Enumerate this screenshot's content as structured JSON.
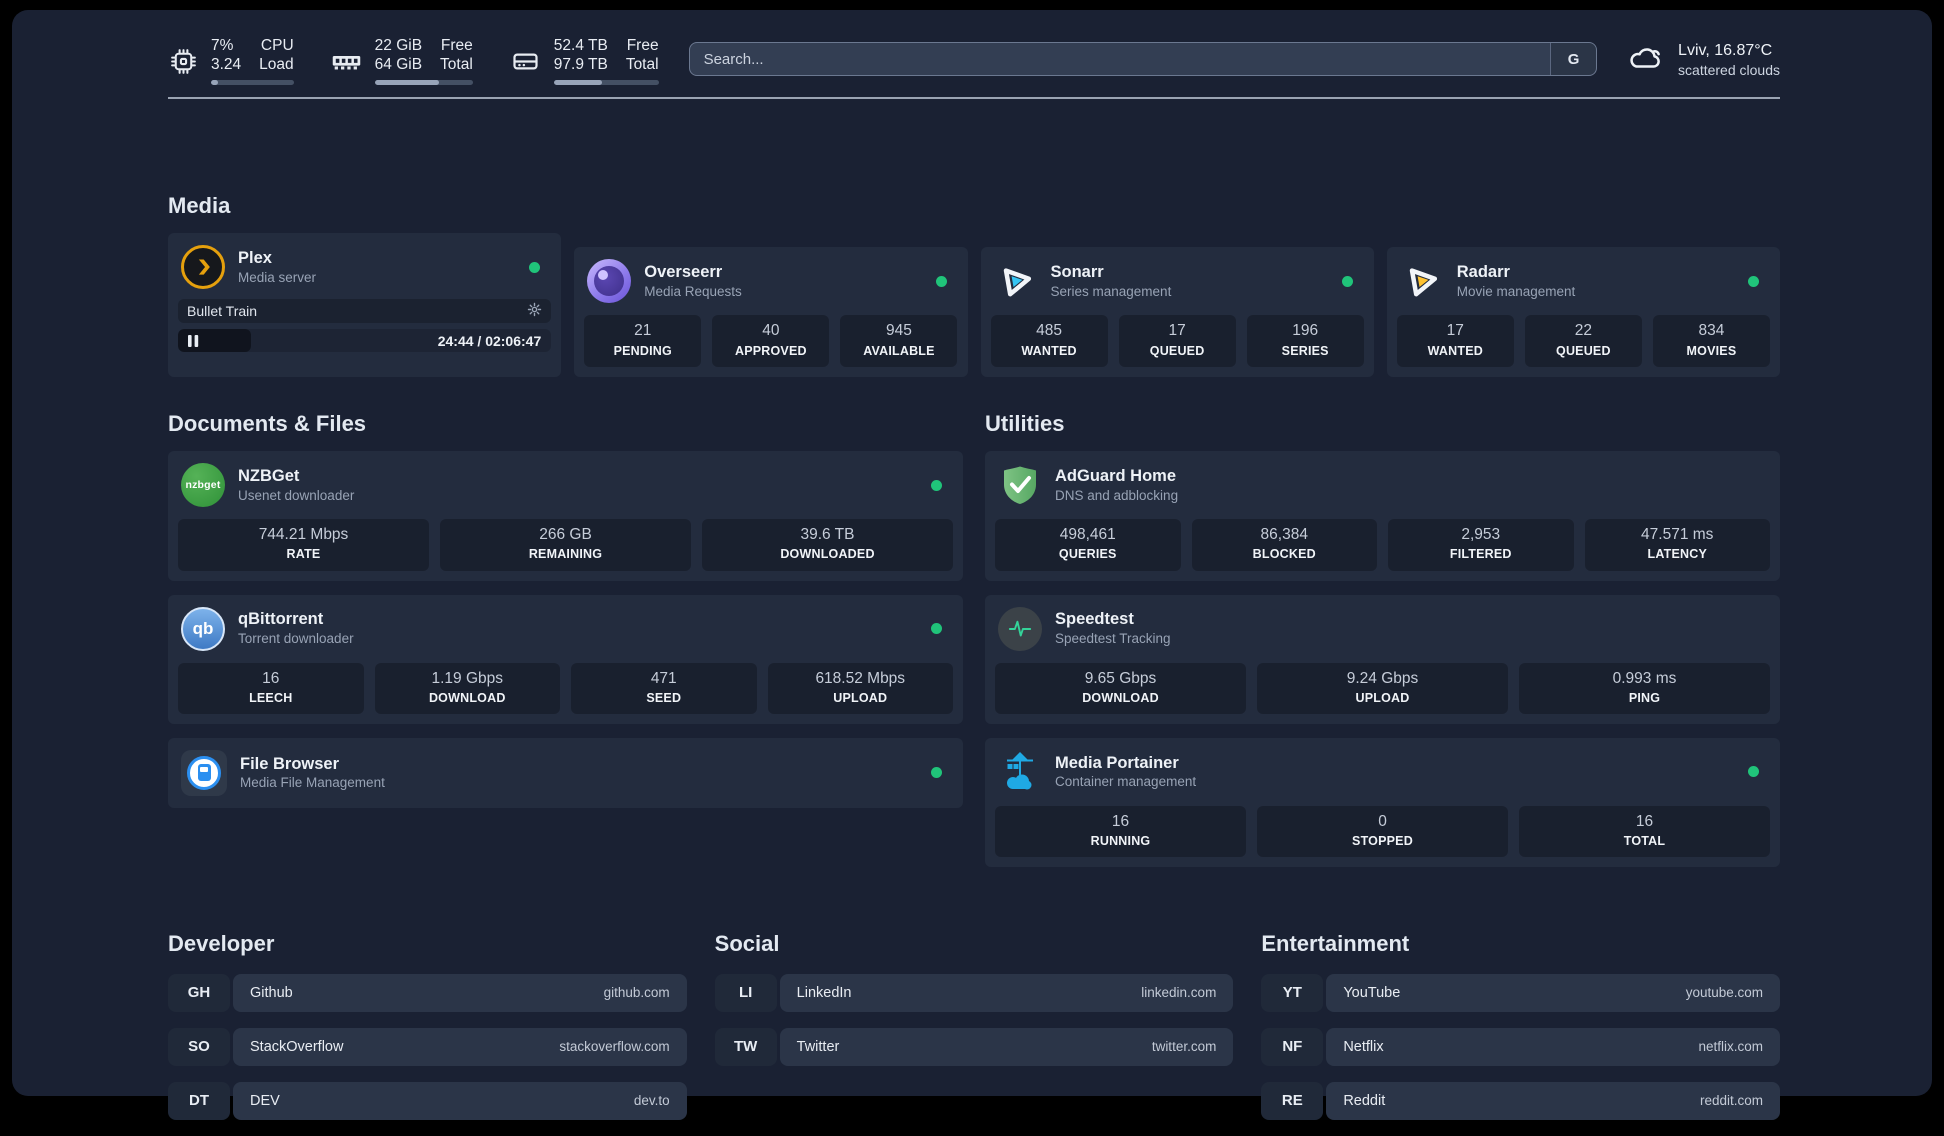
{
  "colors": {
    "status": "#20c47a",
    "plex": "#e5a00d",
    "sonarr": "#35c5f4",
    "radarr": "#ffc230",
    "speedtest_pulse": "#34d399",
    "portainer": "#1fa9e4",
    "adguard_light": "#7ec384",
    "adguard_dark": "#57a863"
  },
  "topbar": {
    "cpu": {
      "value1": "7%",
      "value2": "3.24",
      "label1": "CPU",
      "label2": "Load",
      "percent": 8
    },
    "memory": {
      "value1": "22 GiB",
      "value2": "64 GiB",
      "label1": "Free",
      "label2": "Total",
      "percent": 66
    },
    "disk": {
      "value1": "52.4 TB",
      "value2": "97.9 TB",
      "label1": "Free",
      "label2": "Total",
      "percent": 46
    },
    "search": {
      "placeholder": "Search...",
      "provider": "G"
    },
    "weather": {
      "location": "Lviv, 16.87°C",
      "condition": "scattered clouds"
    }
  },
  "media": {
    "title": "Media",
    "plex": {
      "name": "Plex",
      "desc": "Media server",
      "now_playing": "Bullet Train",
      "time": "24:44 / 02:06:47",
      "progress_percent": 19.5
    },
    "overseerr": {
      "name": "Overseerr",
      "desc": "Media Requests",
      "stats": [
        {
          "value": "21",
          "label": "PENDING"
        },
        {
          "value": "40",
          "label": "APPROVED"
        },
        {
          "value": "945",
          "label": "AVAILABLE"
        }
      ]
    },
    "sonarr": {
      "name": "Sonarr",
      "desc": "Series management",
      "stats": [
        {
          "value": "485",
          "label": "WANTED"
        },
        {
          "value": "17",
          "label": "QUEUED"
        },
        {
          "value": "196",
          "label": "SERIES"
        }
      ]
    },
    "radarr": {
      "name": "Radarr",
      "desc": "Movie management",
      "stats": [
        {
          "value": "17",
          "label": "WANTED"
        },
        {
          "value": "22",
          "label": "QUEUED"
        },
        {
          "value": "834",
          "label": "MOVIES"
        }
      ]
    }
  },
  "documents": {
    "title": "Documents & Files",
    "nzbget": {
      "name": "NZBGet",
      "desc": "Usenet downloader",
      "logo_text": "nzbget",
      "stats": [
        {
          "value": "744.21 Mbps",
          "label": "RATE"
        },
        {
          "value": "266 GB",
          "label": "REMAINING"
        },
        {
          "value": "39.6 TB",
          "label": "DOWNLOADED"
        }
      ]
    },
    "qbittorrent": {
      "name": "qBittorrent",
      "desc": "Torrent downloader",
      "logo_text": "qb",
      "stats": [
        {
          "value": "16",
          "label": "LEECH"
        },
        {
          "value": "1.19 Gbps",
          "label": "DOWNLOAD"
        },
        {
          "value": "471",
          "label": "SEED"
        },
        {
          "value": "618.52 Mbps",
          "label": "UPLOAD"
        }
      ]
    },
    "filebrowser": {
      "name": "File Browser",
      "desc": "Media File Management"
    }
  },
  "utilities": {
    "title": "Utilities",
    "adguard": {
      "name": "AdGuard Home",
      "desc": "DNS and adblocking",
      "stats": [
        {
          "value": "498,461",
          "label": "QUERIES"
        },
        {
          "value": "86,384",
          "label": "BLOCKED"
        },
        {
          "value": "2,953",
          "label": "FILTERED"
        },
        {
          "value": "47.571 ms",
          "label": "LATENCY"
        }
      ]
    },
    "speedtest": {
      "name": "Speedtest",
      "desc": "Speedtest Tracking",
      "stats": [
        {
          "value": "9.65 Gbps",
          "label": "DOWNLOAD"
        },
        {
          "value": "9.24 Gbps",
          "label": "UPLOAD"
        },
        {
          "value": "0.993 ms",
          "label": "PING"
        }
      ]
    },
    "portainer": {
      "name": "Media Portainer",
      "desc": "Container management",
      "stats": [
        {
          "value": "16",
          "label": "RUNNING"
        },
        {
          "value": "0",
          "label": "STOPPED"
        },
        {
          "value": "16",
          "label": "TOTAL"
        }
      ]
    }
  },
  "bookmarks": {
    "developer": {
      "title": "Developer",
      "items": [
        {
          "abbr": "GH",
          "name": "Github",
          "url": "github.com"
        },
        {
          "abbr": "SO",
          "name": "StackOverflow",
          "url": "stackoverflow.com"
        },
        {
          "abbr": "DT",
          "name": "DEV",
          "url": "dev.to"
        }
      ]
    },
    "social": {
      "title": "Social",
      "items": [
        {
          "abbr": "LI",
          "name": "LinkedIn",
          "url": "linkedin.com"
        },
        {
          "abbr": "TW",
          "name": "Twitter",
          "url": "twitter.com"
        }
      ]
    },
    "entertainment": {
      "title": "Entertainment",
      "items": [
        {
          "abbr": "YT",
          "name": "YouTube",
          "url": "youtube.com"
        },
        {
          "abbr": "NF",
          "name": "Netflix",
          "url": "netflix.com"
        },
        {
          "abbr": "RE",
          "name": "Reddit",
          "url": "reddit.com"
        }
      ]
    }
  }
}
